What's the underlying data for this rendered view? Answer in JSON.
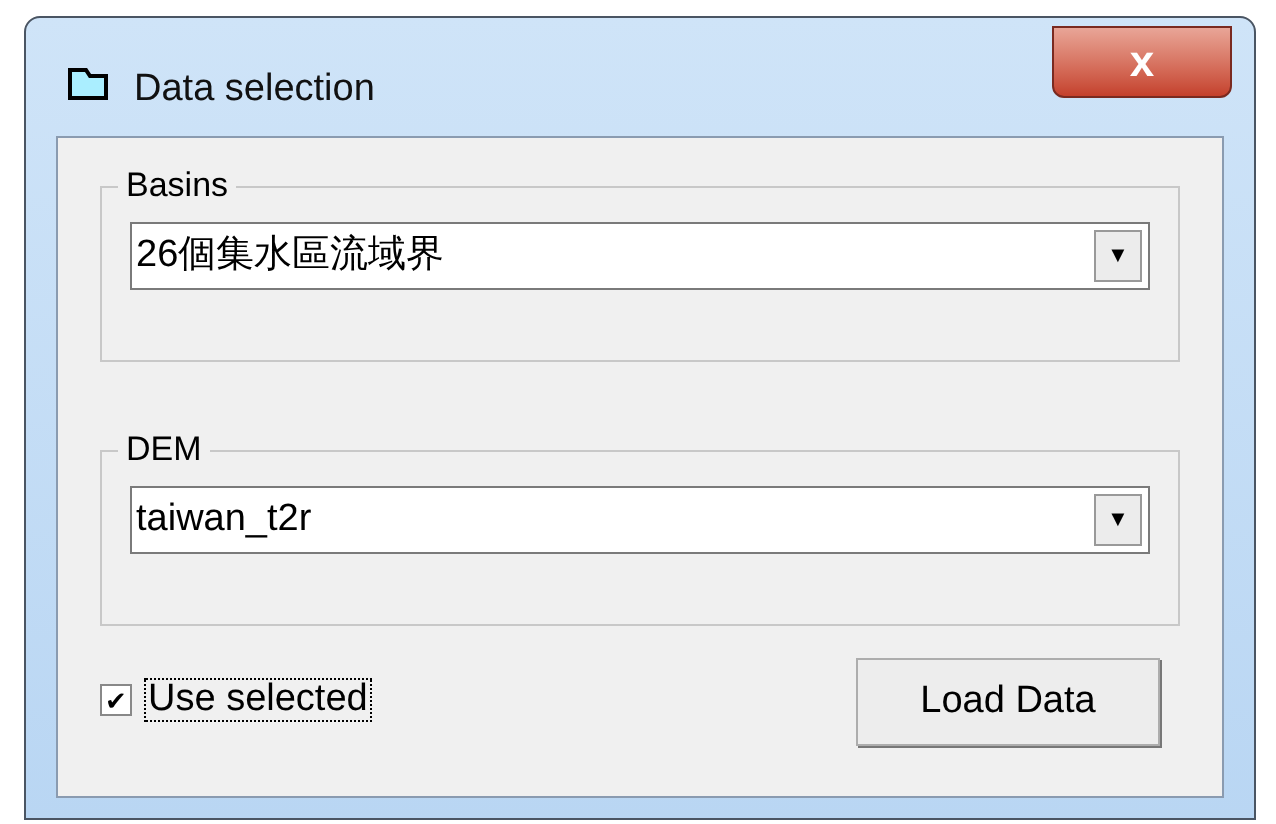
{
  "window": {
    "title": "Data selection",
    "close": "x"
  },
  "groups": [
    {
      "label": "Basins",
      "value": "26個集水區流域界",
      "arrow": "▼"
    },
    {
      "label": "DEM",
      "value": "taiwan_t2r",
      "arrow": "▼"
    }
  ],
  "use_selected": {
    "label": "Use selected",
    "checked": true,
    "check": "✔"
  },
  "button": "Load Data"
}
